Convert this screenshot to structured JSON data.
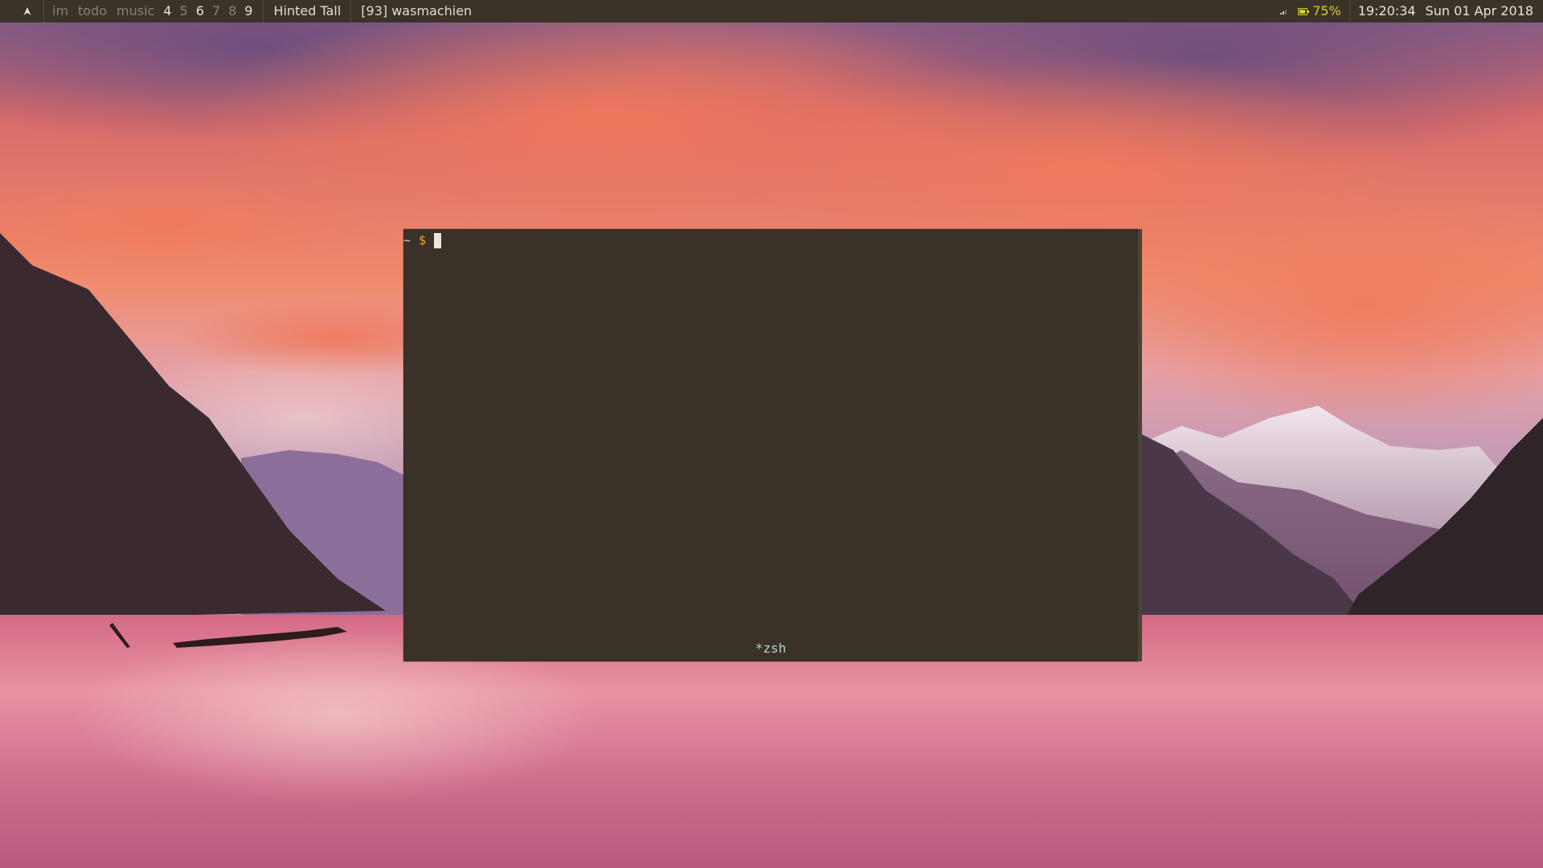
{
  "topbar": {
    "launcher_icon": "arch-launcher-icon",
    "workspaces": [
      {
        "label": "im",
        "state": "inactive"
      },
      {
        "label": "todo",
        "state": "inactive"
      },
      {
        "label": "music",
        "state": "inactive"
      },
      {
        "label": "4",
        "state": "occupied"
      },
      {
        "label": "5",
        "state": "inactive"
      },
      {
        "label": "6",
        "state": "occupied"
      },
      {
        "label": "7",
        "state": "inactive"
      },
      {
        "label": "8",
        "state": "inactive"
      },
      {
        "label": "9",
        "state": "active"
      }
    ],
    "layout": "Hinted Tall",
    "window_title": "[93] wasmachien",
    "network_icon": "signal-icon",
    "battery_icon": "battery-icon",
    "battery": "75%",
    "time": "19:20:34",
    "date": "Sun 01 Apr 2018"
  },
  "terminal": {
    "prompt_dir": "~",
    "prompt_symbol": "$",
    "tab_label": "*zsh"
  },
  "colors": {
    "bar_bg": "#3b3329",
    "bar_text": "#d6cfc3",
    "battery_text": "#d4c83c",
    "terminal_bg": "#3a3128",
    "prompt_accent": "#e8a63c",
    "tab_label": "#b8d4cc"
  }
}
